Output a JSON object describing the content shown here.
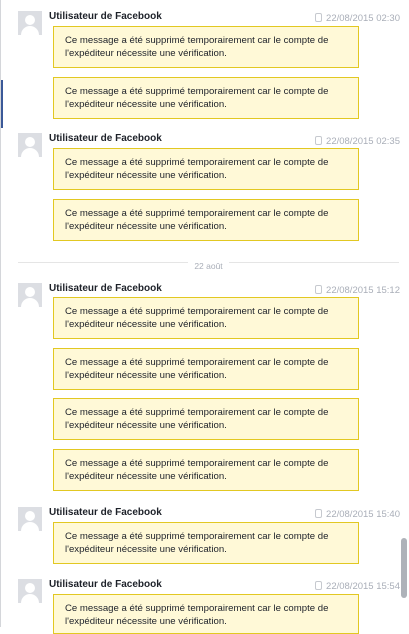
{
  "sender_name": "Utilisateur de Facebook",
  "message_line1": "Ce message a été supprimé temporairement car le compte de",
  "message_line2": "l'expéditeur nécessite une vérification.",
  "date_separator": "22 août",
  "groups": [
    {
      "sender": "Utilisateur de Facebook",
      "timestamp": "22/08/2015 02:30",
      "message_count": 2
    },
    {
      "sender": "Utilisateur de Facebook",
      "timestamp": "22/08/2015 02:35",
      "message_count": 2
    },
    {
      "sender": "Utilisateur de Facebook",
      "timestamp": "22/08/2015 15:12",
      "message_count": 4
    },
    {
      "sender": "Utilisateur de Facebook",
      "timestamp": "22/08/2015 15:40",
      "message_count": 1
    },
    {
      "sender": "Utilisateur de Facebook",
      "timestamp": "22/08/2015 15:54",
      "message_count": 1
    }
  ],
  "colors": {
    "bubble_background": "#fff9d7",
    "bubble_border": "#e2c822",
    "timestamp": "#a9aeb8",
    "accent": "#3b5998"
  }
}
